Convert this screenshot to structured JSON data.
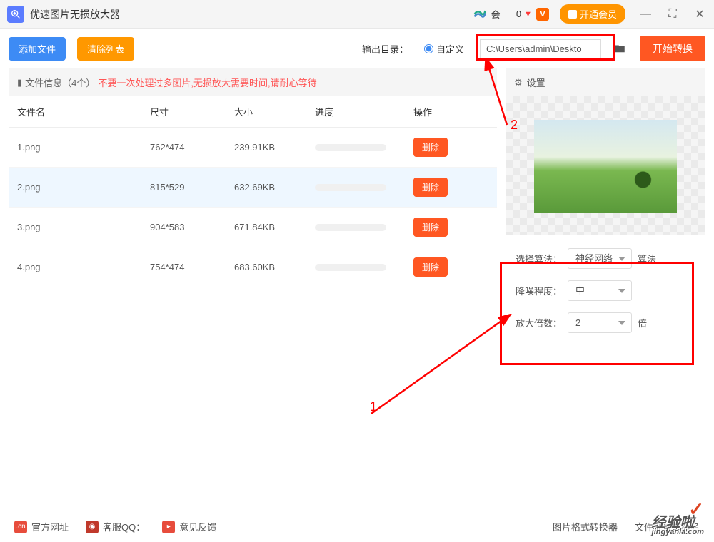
{
  "app": {
    "title": "优速图片无损放大器"
  },
  "titlebar": {
    "account": "会¯",
    "counter": "0",
    "vip_button": "开通会员"
  },
  "toolbar": {
    "add_file": "添加文件",
    "clear_list": "清除列表",
    "output_label": "输出目录：",
    "custom_label": "自定义",
    "path_value": "C:\\Users\\admin\\Deskto",
    "start": "开始转换"
  },
  "file_info": {
    "icon": "▮",
    "label": "文件信息（4个）",
    "warning": "不要一次处理过多图片,无损放大需要时间,请耐心等待"
  },
  "columns": {
    "name": "文件名",
    "dim": "尺寸",
    "size": "大小",
    "progress": "进度",
    "op": "操作"
  },
  "rows": [
    {
      "name": "1.png",
      "dim": "762*474",
      "size": "239.91KB",
      "op": "删除"
    },
    {
      "name": "2.png",
      "dim": "815*529",
      "size": "632.69KB",
      "op": "删除"
    },
    {
      "name": "3.png",
      "dim": "904*583",
      "size": "671.84KB",
      "op": "删除"
    },
    {
      "name": "4.png",
      "dim": "754*474",
      "size": "683.60KB",
      "op": "删除"
    }
  ],
  "settings": {
    "header": "设置",
    "algo_label": "选择算法：",
    "algo_value": "神经网络",
    "algo_suffix": "算法",
    "noise_label": "降噪程度：",
    "noise_value": "中",
    "scale_label": "放大倍数：",
    "scale_value": "2",
    "scale_suffix": "倍"
  },
  "footer": {
    "official": "官方网址",
    "qq": "客服QQ：",
    "feedback": "意见反馈",
    "fmt_convert": "图片格式转换器",
    "batch_rename": "文件批量重命名"
  },
  "annotations": {
    "n1": "1",
    "n2": "2"
  },
  "watermark": {
    "main": "经验啦",
    "sub": "jingyanla.com"
  }
}
